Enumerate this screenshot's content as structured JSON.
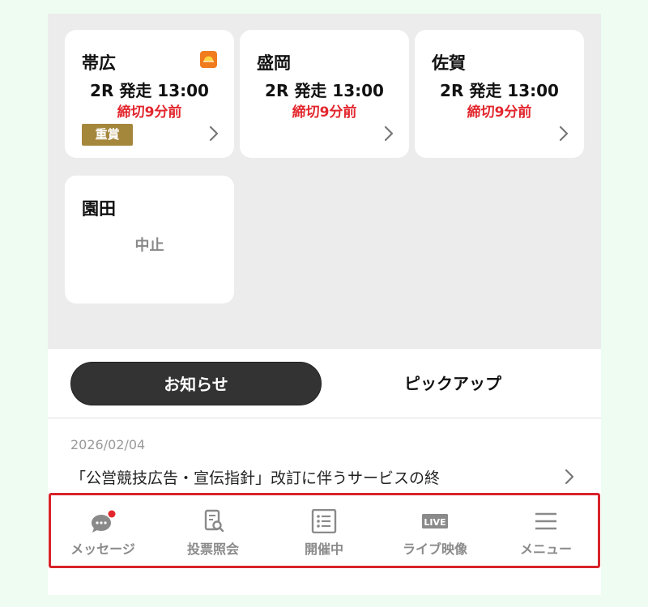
{
  "races": [
    {
      "venue": "帯広",
      "race_time": "2R 発走 13:00",
      "deadline": "締切9分前",
      "badge": "重賞",
      "weather_icon": "weather-sun-icon",
      "status": ""
    },
    {
      "venue": "盛岡",
      "race_time": "2R 発走 13:00",
      "deadline": "締切9分前",
      "badge": "",
      "status": ""
    },
    {
      "venue": "佐賀",
      "race_time": "2R 発走 13:00",
      "deadline": "締切9分前",
      "badge": "",
      "status": ""
    },
    {
      "venue": "園田",
      "race_time": "",
      "deadline": "",
      "badge": "",
      "status": "中止"
    }
  ],
  "tabs": [
    {
      "label": "お知らせ",
      "active": true
    },
    {
      "label": "ピックアップ",
      "active": false
    }
  ],
  "news": {
    "date": "2026/02/04",
    "title": "「公営競技広告・宣伝指針」改訂に伴うサービスの終"
  },
  "bottom_nav": [
    {
      "label": "メッセージ",
      "icon": "message-icon"
    },
    {
      "label": "投票照会",
      "icon": "vote-inquiry-icon"
    },
    {
      "label": "開催中",
      "icon": "list-icon"
    },
    {
      "label": "ライブ映像",
      "icon": "live-icon",
      "icon_text": "LIVE"
    },
    {
      "label": "メニュー",
      "icon": "menu-icon"
    }
  ],
  "colors": {
    "accent_red": "#e2262d",
    "badge_gold": "#a5873c",
    "tab_active": "#333333",
    "nav_gray": "#8a8a8a",
    "highlight_border": "#d8232a"
  }
}
